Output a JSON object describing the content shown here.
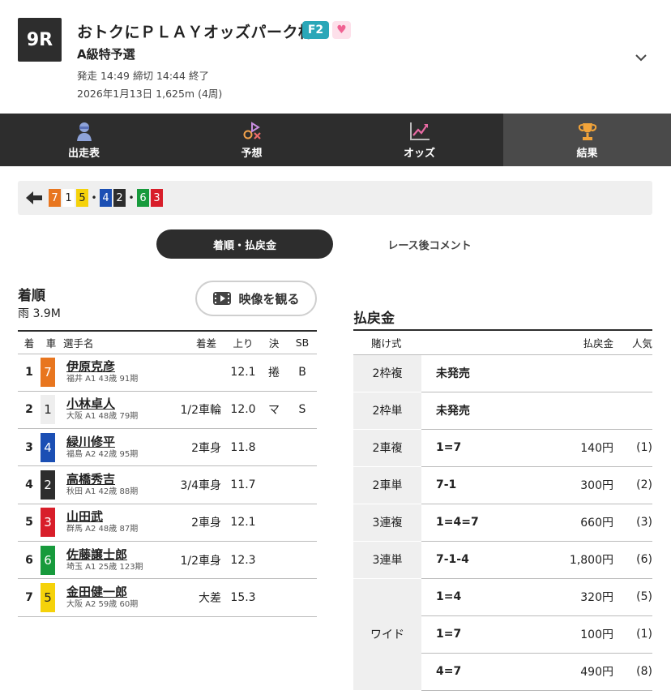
{
  "header": {
    "race_no": "9R",
    "title": "おトクにＰＬＡＹオッズパーク杯",
    "grade": "F2",
    "class": "A級特予選",
    "time_line": "発走 14:49 締切 14:44  終了",
    "date_line": "2026年1月13日 1,625m (4周)"
  },
  "tabs": [
    {
      "label": "出走表",
      "icon": "racer-icon"
    },
    {
      "label": "予想",
      "icon": "prediction-icon"
    },
    {
      "label": "オッズ",
      "icon": "chart-icon"
    },
    {
      "label": "結果",
      "icon": "trophy-icon"
    }
  ],
  "order_strip": [
    {
      "type": "car",
      "num": "7",
      "bg": "#e8761f",
      "fg": "#ffffff"
    },
    {
      "type": "car",
      "num": "1",
      "bg": "#ffffff",
      "fg": "#222222"
    },
    {
      "type": "car",
      "num": "5",
      "bg": "#f5d20a",
      "fg": "#222222"
    },
    {
      "type": "sep",
      "text": "•"
    },
    {
      "type": "car",
      "num": "4",
      "bg": "#1b4fb4",
      "fg": "#ffffff"
    },
    {
      "type": "car",
      "num": "2",
      "bg": "#2d2d2d",
      "fg": "#ffffff"
    },
    {
      "type": "sep",
      "text": "•"
    },
    {
      "type": "car",
      "num": "6",
      "bg": "#179a3c",
      "fg": "#ffffff"
    },
    {
      "type": "car",
      "num": "3",
      "bg": "#d81e2a",
      "fg": "#ffffff"
    }
  ],
  "segments": {
    "active": "着順・払戻金",
    "inactive": "レース後コメント"
  },
  "results": {
    "title": "着順",
    "weather": "雨  3.9M",
    "video_label": "映像を観る",
    "headers": [
      "着",
      "車",
      "選手名",
      "着差",
      "上り",
      "決",
      "SB"
    ],
    "rows": [
      {
        "rank": "1",
        "car": "7",
        "bg": "#e8761f",
        "fg": "#ffffff",
        "name": "伊原克彦",
        "sub": "福井 A1 43歳 91期",
        "margin": "",
        "time": "12.1",
        "kim": "捲",
        "sb": "B"
      },
      {
        "rank": "2",
        "car": "1",
        "bg": "#eeeeee",
        "fg": "#222222",
        "name": "小林卓人",
        "sub": "大阪 A1 48歳 79期",
        "margin": "1/2車輪",
        "time": "12.0",
        "kim": "マ",
        "sb": "S"
      },
      {
        "rank": "3",
        "car": "4",
        "bg": "#1b4fb4",
        "fg": "#ffffff",
        "name": "緑川修平",
        "sub": "福島 A2 42歳 95期",
        "margin": "2車身",
        "time": "11.8",
        "kim": "",
        "sb": ""
      },
      {
        "rank": "4",
        "car": "2",
        "bg": "#2d2d2d",
        "fg": "#ffffff",
        "name": "高橋秀吉",
        "sub": "秋田 A1 42歳 88期",
        "margin": "3/4車身",
        "time": "11.7",
        "kim": "",
        "sb": ""
      },
      {
        "rank": "5",
        "car": "3",
        "bg": "#d81e2a",
        "fg": "#ffffff",
        "name": "山田武",
        "sub": "群馬 A2 48歳 87期",
        "margin": "2車身",
        "time": "12.1",
        "kim": "",
        "sb": ""
      },
      {
        "rank": "6",
        "car": "6",
        "bg": "#179a3c",
        "fg": "#ffffff",
        "name": "佐藤譲士郎",
        "sub": "埼玉 A1 25歳 123期",
        "margin": "1/2車身",
        "time": "12.3",
        "kim": "",
        "sb": ""
      },
      {
        "rank": "7",
        "car": "5",
        "bg": "#f5d20a",
        "fg": "#222222",
        "name": "金田健一郎",
        "sub": "大阪 A2 59歳 60期",
        "margin": "大差",
        "time": "15.3",
        "kim": "",
        "sb": ""
      }
    ]
  },
  "payout": {
    "title": "払戻金",
    "headers": [
      "賭け式",
      "払戻金",
      "人気"
    ],
    "rows": [
      {
        "kind": "2枠複",
        "span": 1,
        "combo": "未発売",
        "amount": "",
        "pop": ""
      },
      {
        "kind": "2枠単",
        "span": 1,
        "combo": "未発売",
        "amount": "",
        "pop": ""
      },
      {
        "kind": "2車複",
        "span": 1,
        "combo": "1=7",
        "amount": "140円",
        "pop": "(1)"
      },
      {
        "kind": "2車単",
        "span": 1,
        "combo": "7-1",
        "amount": "300円",
        "pop": "(2)"
      },
      {
        "kind": "3連複",
        "span": 1,
        "combo": "1=4=7",
        "amount": "660円",
        "pop": "(3)"
      },
      {
        "kind": "3連単",
        "span": 1,
        "combo": "7-1-4",
        "amount": "1,800円",
        "pop": "(6)"
      },
      {
        "kind": "ワイド",
        "span": 3,
        "combo": "1=4",
        "amount": "320円",
        "pop": "(5)"
      },
      {
        "kind": "",
        "span": 0,
        "combo": "1=7",
        "amount": "100円",
        "pop": "(1)"
      },
      {
        "kind": "",
        "span": 0,
        "combo": "4=7",
        "amount": "490円",
        "pop": "(8)"
      }
    ]
  }
}
